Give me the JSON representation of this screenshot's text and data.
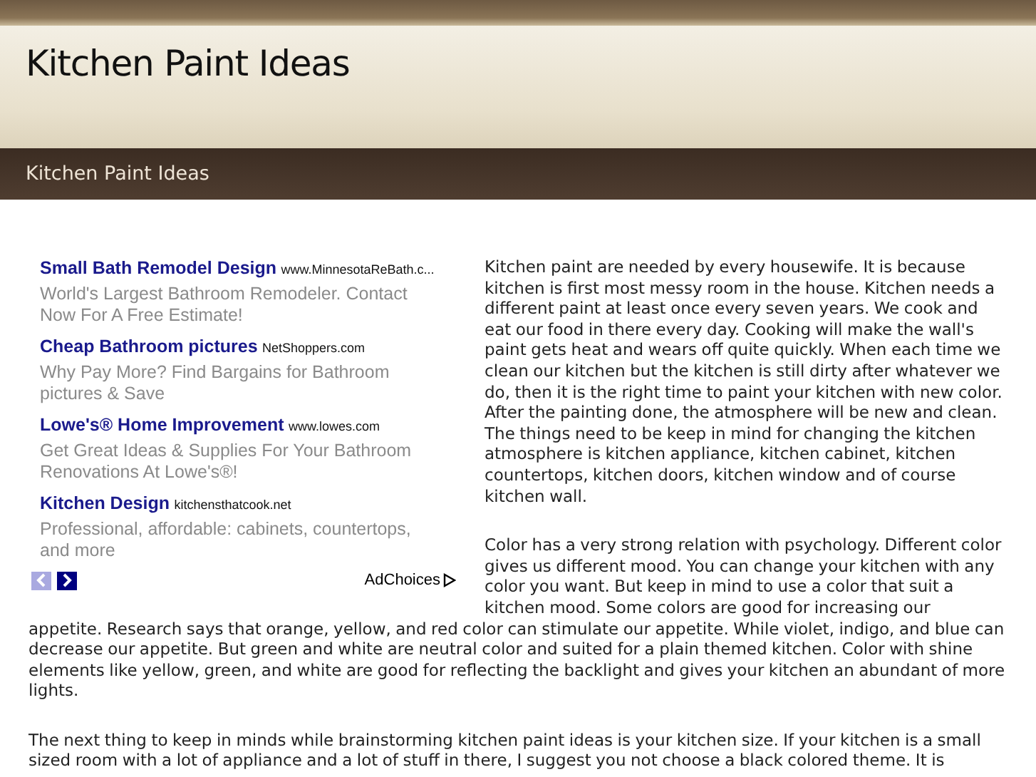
{
  "header": {
    "title": "Kitchen Paint Ideas"
  },
  "nav": {
    "items": [
      {
        "label": "Kitchen Paint Ideas"
      }
    ]
  },
  "ads": {
    "items": [
      {
        "title": "Small Bath Remodel Design",
        "url": "www.MinnesotaReBath.c...",
        "description": "World's Largest Bathroom Remodeler. Contact Now For A Free Estimate!"
      },
      {
        "title": "Cheap Bathroom pictures",
        "url": "NetShoppers.com",
        "description": "Why Pay More? Find Bargains for Bathroom pictures & Save"
      },
      {
        "title": "Lowe's® Home Improvement",
        "url": "www.lowes.com",
        "description": "Get Great Ideas & Supplies For Your Bathroom Renovations At Lowe's®!"
      },
      {
        "title": "Kitchen Design",
        "url": "kitchensthatcook.net",
        "description": "Professional, affordable: cabinets, countertops, and more"
      }
    ],
    "prev_disabled": true,
    "next_disabled": false,
    "adchoices": "AdChoices"
  },
  "article": {
    "beside_ads": [
      "Kitchen paint are needed by every housewife. It is because kitchen is first most messy room in the house. Kitchen needs a different paint at least once every seven years. We cook and eat our food in there every day. Cooking will make the wall's paint gets heat and wears off quite quickly. When each time we clean our kitchen but the kitchen is still dirty after whatever we do, then it is the right time to paint your kitchen with new color. After the painting done, the atmosphere will be new and clean. The things need to be keep in mind for changing the kitchen atmosphere is kitchen appliance, kitchen cabinet, kitchen countertops, kitchen doors, kitchen window and of course kitchen wall.",
      "Color has a very strong relation with psychology. Different color gives us different mood. You can change your kitchen with any color you want. But keep in mind to use a color that suit a kitchen mood. Some colors are good for increasing our"
    ],
    "below_ads": [
      "appetite. Research says that orange, yellow, and red color can stimulate our appetite. While violet, indigo, and blue can decrease our appetite. But green and white are neutral color and suited for a plain themed kitchen. Color with shine elements like yellow, green, and white are good for reflecting the backlight and gives your kitchen an abundant of more lights.",
      "The next thing to keep in minds while brainstorming kitchen paint ideas is your kitchen size. If your kitchen is a small sized room with a lot of appliance and a lot of stuff in there, I suggest you not choose a black colored theme. It is"
    ]
  }
}
